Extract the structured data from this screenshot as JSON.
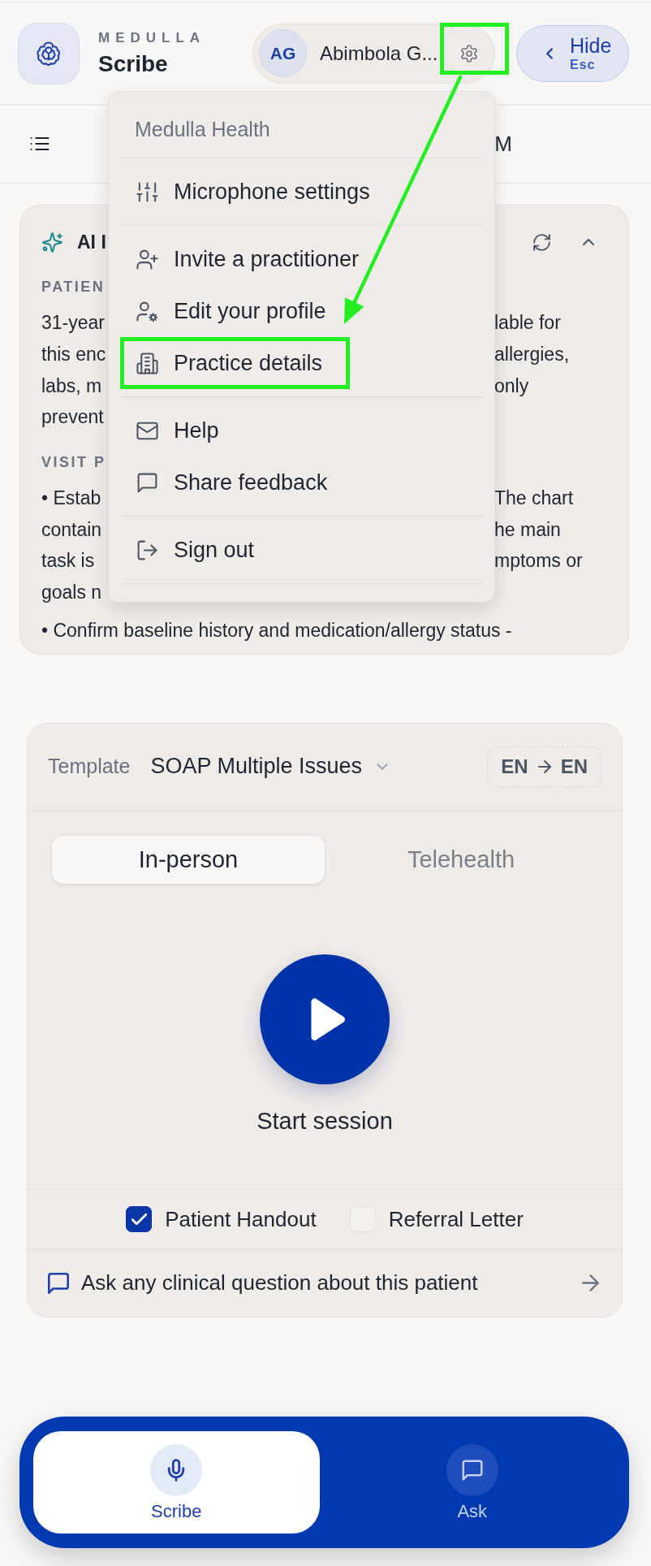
{
  "header": {
    "brand_overline": "MEDULLA",
    "brand_title": "Scribe",
    "user": {
      "initials": "AG",
      "name": "Abimbola G...",
      "settings_highlighted": true
    },
    "hide_button": {
      "label": "Hide",
      "shortcut": "Esc"
    }
  },
  "subbar": {
    "text": "M"
  },
  "menu": {
    "title": "Medulla Health",
    "groups": [
      [
        {
          "label": "Microphone settings",
          "highlighted": false
        }
      ],
      [
        {
          "label": "Invite a practitioner",
          "highlighted": false
        },
        {
          "label": "Edit your profile",
          "highlighted": false
        },
        {
          "label": "Practice details",
          "highlighted": true
        }
      ],
      [
        {
          "label": "Help",
          "highlighted": false
        },
        {
          "label": "Share feedback",
          "highlighted": false
        }
      ],
      [
        {
          "label": "Sign out",
          "highlighted": false
        }
      ]
    ]
  },
  "annotation_arrow": true,
  "ai_card": {
    "title": "AI I",
    "expanded": true,
    "sections": [
      {
        "heading": "PATIEN",
        "lines": [
          {
            "kind": "split",
            "left": "31-year",
            "right": "lable for"
          },
          {
            "kind": "split",
            "left": "this enc",
            "right": "allergies,"
          },
          {
            "kind": "split",
            "left": "labs, m",
            "right": "only"
          },
          {
            "kind": "split",
            "left": "prevent"
          }
        ]
      },
      {
        "heading": "VISIT P",
        "lines": [
          {
            "kind": "split",
            "left": "• Estab",
            "right": "The chart"
          },
          {
            "kind": "split",
            "left": "contain",
            "right": "he main"
          },
          {
            "kind": "split",
            "left": "task is",
            "right": "mptoms or"
          },
          {
            "kind": "split",
            "left": "goals n"
          },
          {
            "kind": "full",
            "text": "• Confirm baseline history and medication/allergy status -"
          }
        ]
      }
    ]
  },
  "template_card": {
    "label": "Template",
    "value": "SOAP Multiple Issues",
    "language": {
      "source": "EN",
      "target": "EN"
    },
    "modes": [
      {
        "label": "In-person",
        "selected": true
      },
      {
        "label": "Telehealth",
        "selected": false
      }
    ],
    "start_label": "Start session",
    "outputs": [
      {
        "label": "Patient Handout",
        "checked": true
      },
      {
        "label": "Referral Letter",
        "checked": false
      }
    ],
    "ask_prompt": "Ask any clinical question about this patient"
  },
  "bottom_nav": [
    {
      "label": "Scribe",
      "selected": true
    },
    {
      "label": "Ask",
      "selected": false
    }
  ]
}
